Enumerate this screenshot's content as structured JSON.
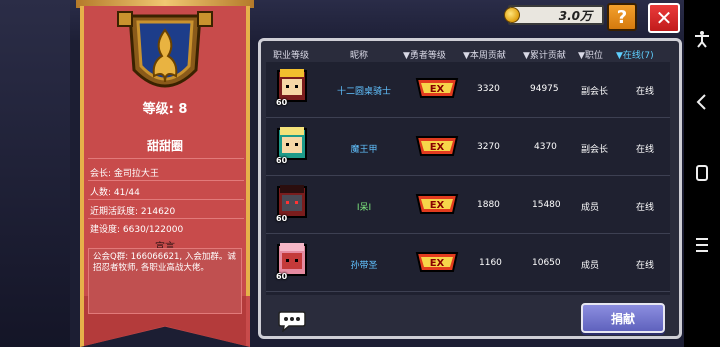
{
  "topbar": {
    "coins": "3.0万",
    "help_label": "?",
    "close_label": "✕"
  },
  "guild": {
    "level_label": "等级: 8",
    "name": "甜甜圈",
    "leader": "会长: 金司拉大王",
    "members": "人数: 41/44",
    "activity": "近期活跃度: 214620",
    "construction": "建设度: 6630/122000",
    "declaration_title": "宣言",
    "declaration_text": "公会Q群: 166066621, 入会加群。诚招忍者牧师, 各职业高战大佬。"
  },
  "table": {
    "headers": {
      "class_level": "职业等级",
      "nickname": "昵称",
      "hero_level": "▼勇者等级",
      "weekly": "▼本周贡献",
      "total": "▼累计贡献",
      "position": "▼职位",
      "online": "▼在线(7)"
    },
    "rows": [
      {
        "level": "60",
        "nickname": "十二圆桌骑士",
        "weekly": "3320",
        "total": "94975",
        "position": "副会长",
        "status": "在线"
      },
      {
        "level": "60",
        "nickname": "魔王甲",
        "weekly": "3270",
        "total": "4370",
        "position": "副会长",
        "status": "在线"
      },
      {
        "level": "60",
        "nickname": "I呆I",
        "weekly": "1880",
        "total": "15480",
        "position": "成员",
        "status": "在线"
      },
      {
        "level": "60",
        "nickname": "孙带圣",
        "weekly": "1160",
        "total": "10650",
        "position": "成员",
        "status": "在线"
      }
    ],
    "ex_label": "EX"
  },
  "actions": {
    "donate_label": "捐献"
  },
  "nav": {
    "accessibility_icon": "accessibility-icon",
    "back_icon": "back-icon",
    "home_icon": "home-icon",
    "menu_icon": "menu-icon"
  }
}
